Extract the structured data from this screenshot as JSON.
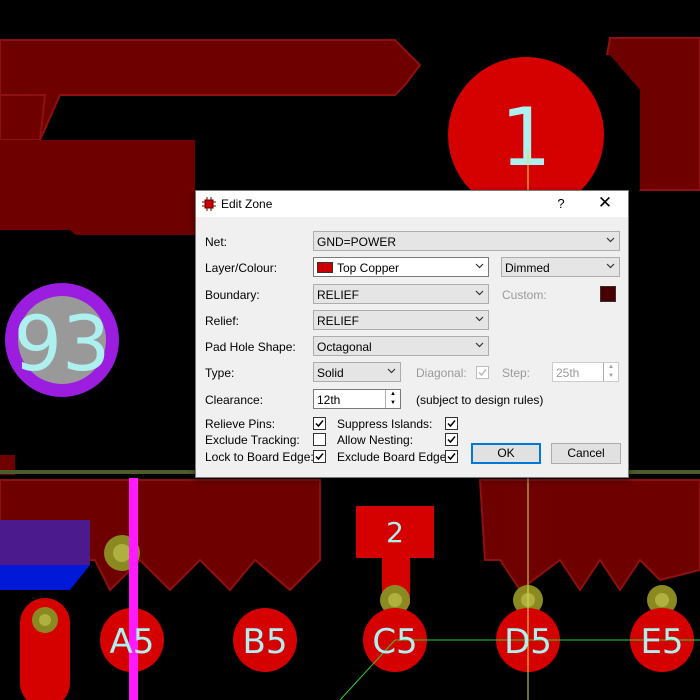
{
  "pcb": {
    "pads": [
      {
        "label": "1"
      },
      {
        "label": "93"
      },
      {
        "label": "2"
      },
      {
        "label": "A5"
      },
      {
        "label": "B5"
      },
      {
        "label": "C5"
      },
      {
        "label": "D5"
      },
      {
        "label": "E5"
      }
    ]
  },
  "dialog": {
    "title": "Edit Zone",
    "help": "?",
    "close": "✕",
    "fields": {
      "net": {
        "label": "Net:",
        "value": "GND=POWER"
      },
      "layer": {
        "label": "Layer/Colour:",
        "value": "Top Copper",
        "swatch_color": "#cc0000"
      },
      "display": {
        "value": "Dimmed"
      },
      "custom": {
        "label": "Custom:",
        "color": "#4a0000"
      },
      "boundary": {
        "label": "Boundary:",
        "value": "RELIEF"
      },
      "relief": {
        "label": "Relief:",
        "value": "RELIEF"
      },
      "pad_hole_shape": {
        "label": "Pad Hole Shape:",
        "value": "Octagonal"
      },
      "type": {
        "label": "Type:",
        "value": "Solid"
      },
      "diagonal": {
        "label": "Diagonal:",
        "checked": true
      },
      "step": {
        "label": "Step:",
        "value": "25th"
      },
      "clearance": {
        "label": "Clearance:",
        "value": "12th",
        "note": "(subject to design rules)"
      }
    },
    "checkboxes": {
      "relieve_pins": {
        "label": "Relieve Pins:",
        "checked": true
      },
      "exclude_tracking": {
        "label": "Exclude Tracking:",
        "checked": false
      },
      "lock_to_board_edge": {
        "label": "Lock to Board Edge:",
        "checked": true
      },
      "suppress_islands": {
        "label": "Suppress Islands:",
        "checked": true
      },
      "allow_nesting": {
        "label": "Allow Nesting:",
        "checked": true
      },
      "exclude_board_edge": {
        "label": "Exclude Board Edge:",
        "checked": true
      }
    },
    "buttons": {
      "ok": "OK",
      "cancel": "Cancel"
    }
  }
}
